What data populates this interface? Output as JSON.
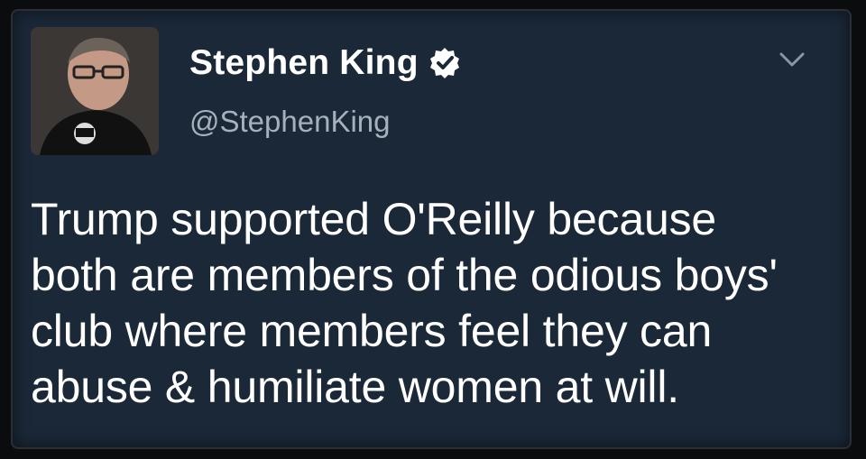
{
  "tweet": {
    "author": {
      "display_name": "Stephen King",
      "handle": "@StephenKing",
      "verified": true,
      "avatar_icon": "profile-photo"
    },
    "menu_icon": "chevron-down-icon",
    "text_lines": [
      "Trump supported O'Reilly because",
      "both are members of the odious boys'",
      "club where members feel they can",
      "abuse & humiliate women at will."
    ]
  },
  "colors": {
    "card_background": "#1b2838",
    "text_primary": "#ffffff",
    "text_secondary": "#a7b1bb",
    "verified_badge": "#ffffff"
  }
}
